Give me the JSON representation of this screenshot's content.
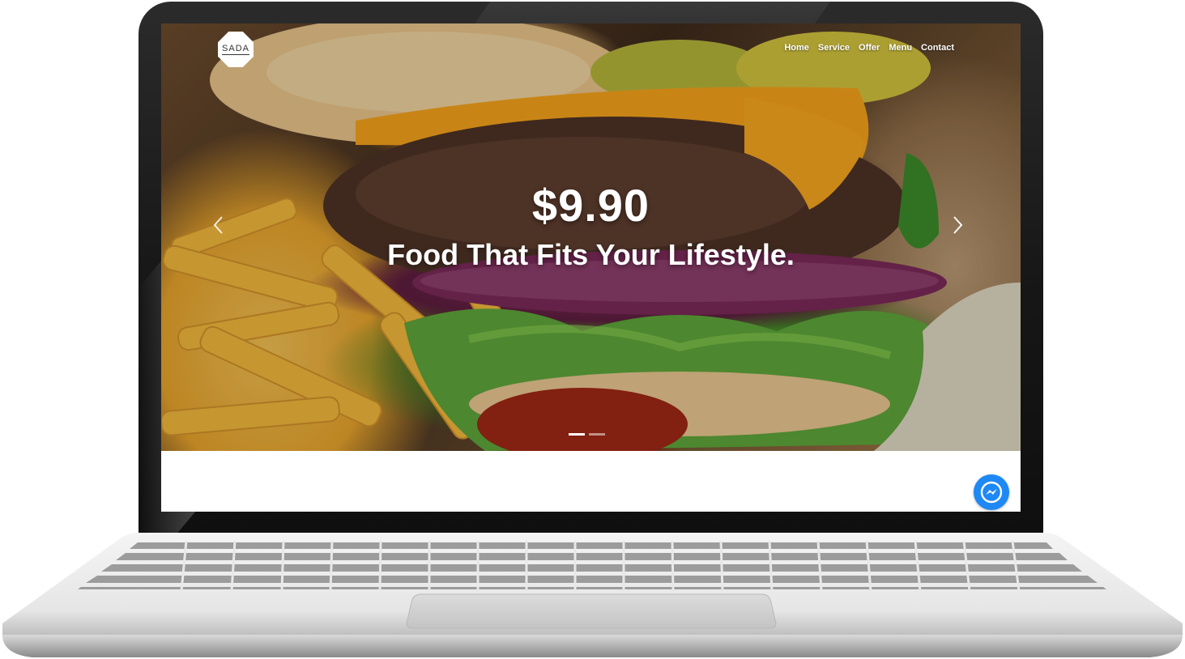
{
  "site": {
    "logo_text": "SADA",
    "nav": [
      "Home",
      "Service",
      "Offer",
      "Menu",
      "Contact"
    ]
  },
  "hero": {
    "price": "$9.90",
    "tagline": "Food That Fits Your Lifestyle.",
    "slides_total": 2,
    "active_slide": 1
  },
  "icons": {
    "prev": "chevron-left-icon",
    "next": "chevron-right-icon",
    "chat": "messenger-icon"
  },
  "colors": {
    "messenger_blue": "#1e88f5",
    "nav_text": "#ffffff"
  }
}
